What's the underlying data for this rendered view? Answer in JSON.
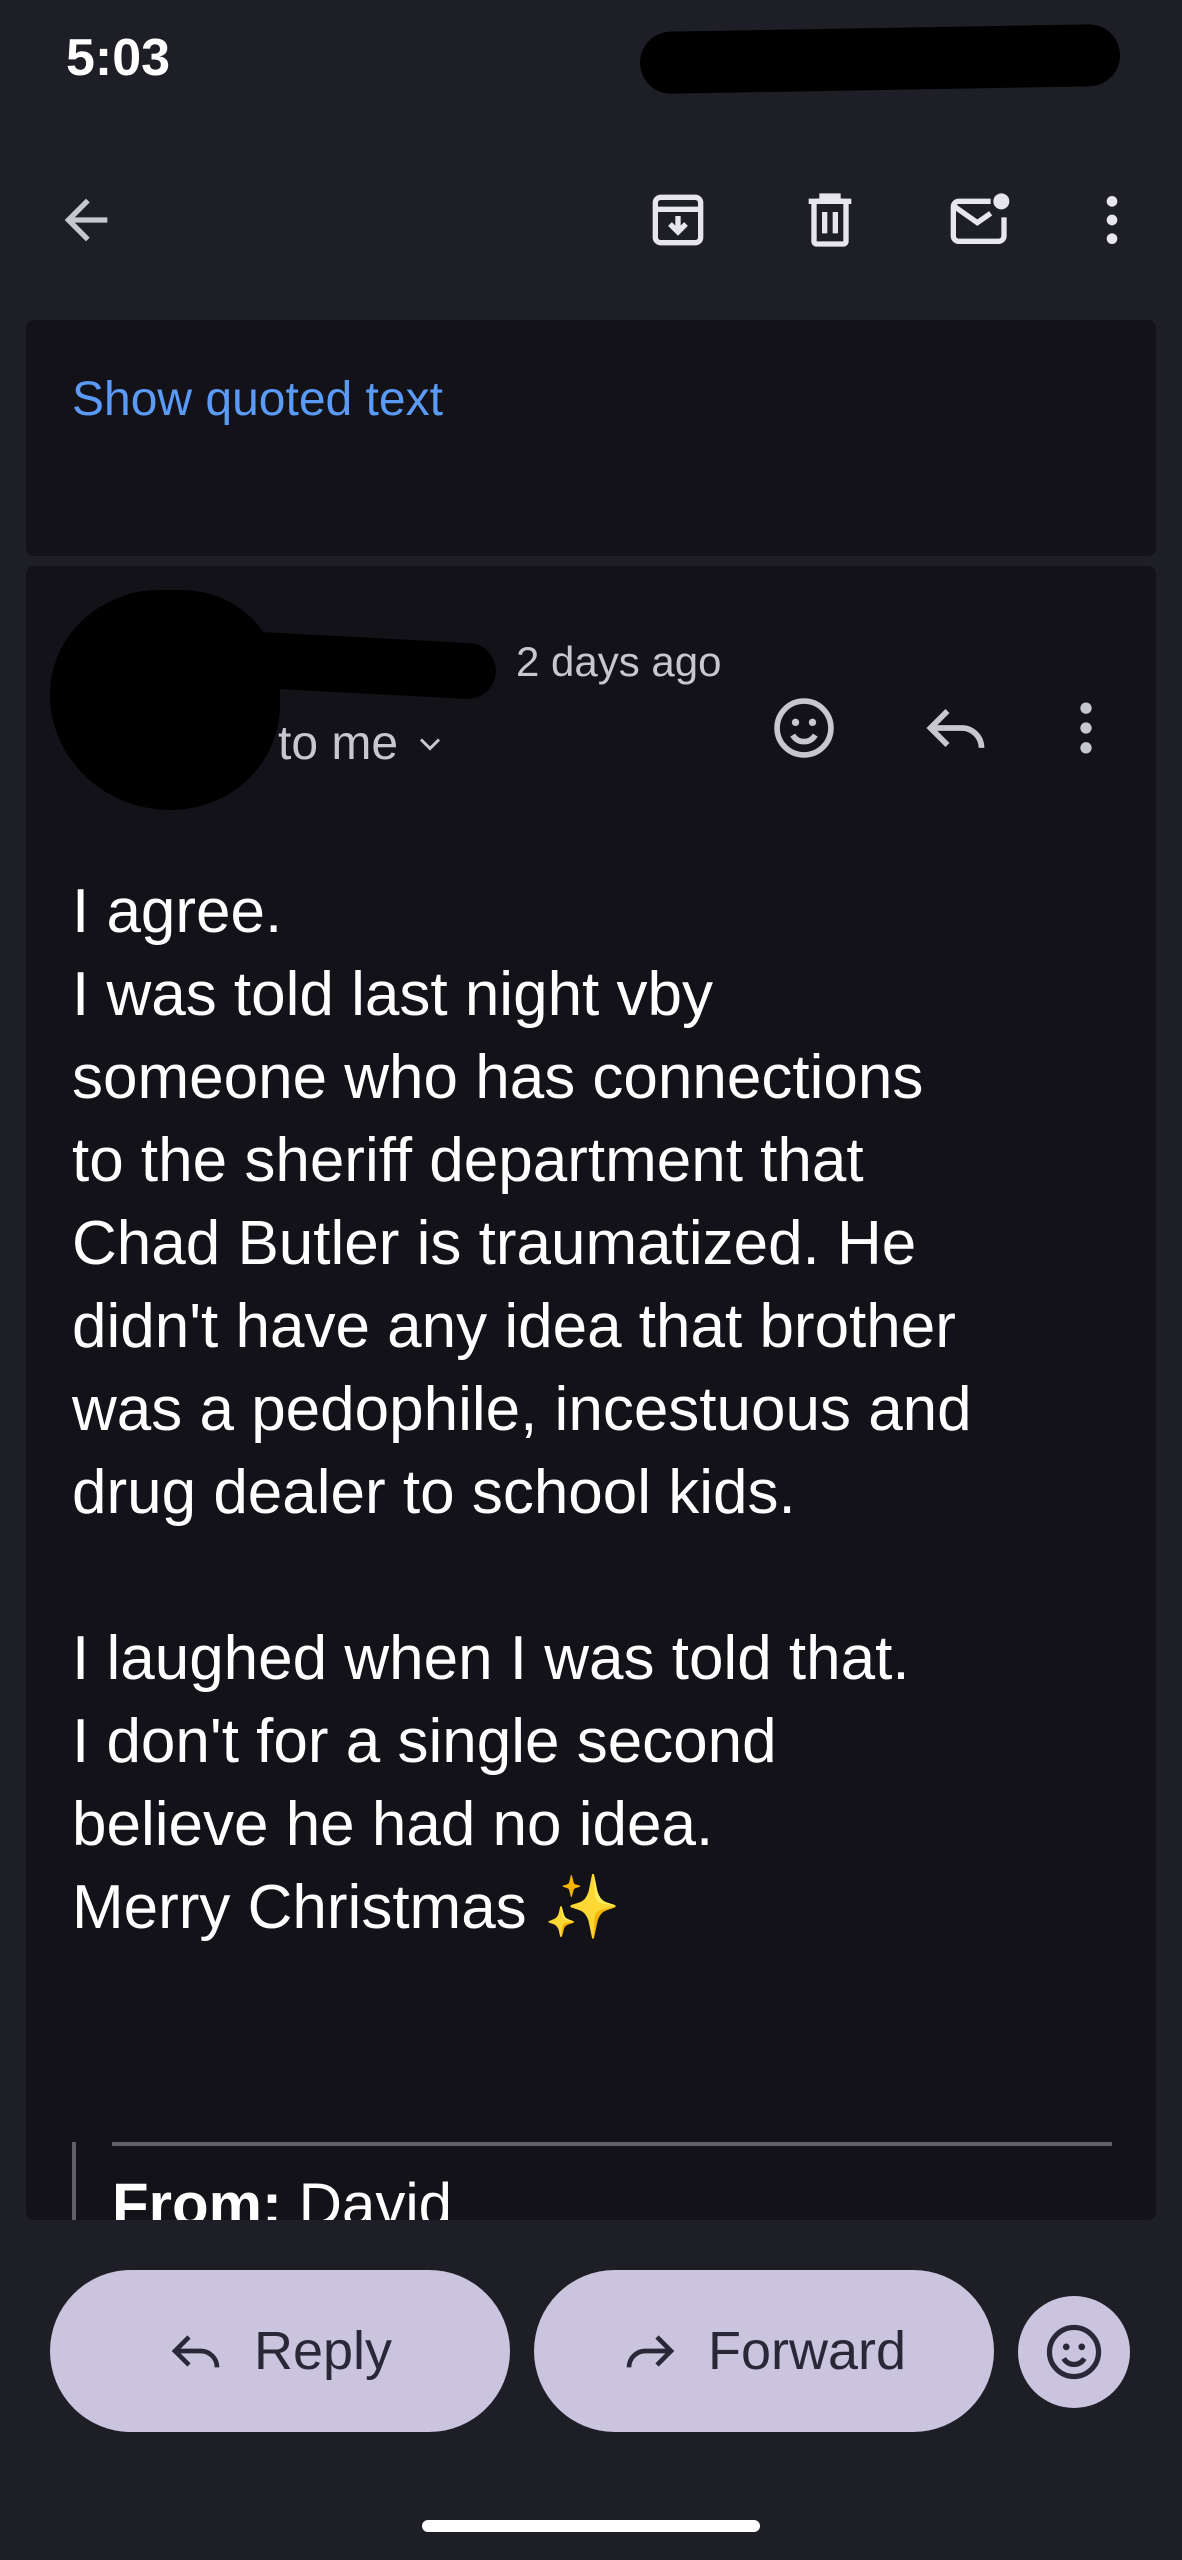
{
  "status_bar": {
    "time": "5:03"
  },
  "toolbar": {
    "back_icon": "arrow-back-icon",
    "archive_icon": "archive-icon",
    "delete_icon": "trash-icon",
    "mark_unread_icon": "mail-unread-icon",
    "more_icon": "more-vert-icon"
  },
  "quoted": {
    "show_quoted_label": "Show quoted text"
  },
  "message": {
    "time_ago": "2 days ago",
    "recipient": "to me",
    "body_lines": [
      "I agree.",
      "I was told last night vby",
      "someone who has connections",
      "to the sheriff department that",
      "Chad Butler is traumatized. He",
      "didn't have any idea that brother",
      "was a pedophile, incestuous and",
      "drug dealer to school kids.",
      "",
      "I laughed when I was told that.",
      "I don't for a single second",
      "believe he had no idea.",
      "Merry Christmas ✨"
    ],
    "quote_from_label": "From:",
    "quote_from_name": "David"
  },
  "actions": {
    "reply_label": "Reply",
    "forward_label": "Forward",
    "emoji_icon": "add-reaction-icon"
  },
  "colors": {
    "background": "#1e1e26",
    "card": "#121218",
    "link": "#5b9bf7",
    "pill": "#cac4df"
  }
}
